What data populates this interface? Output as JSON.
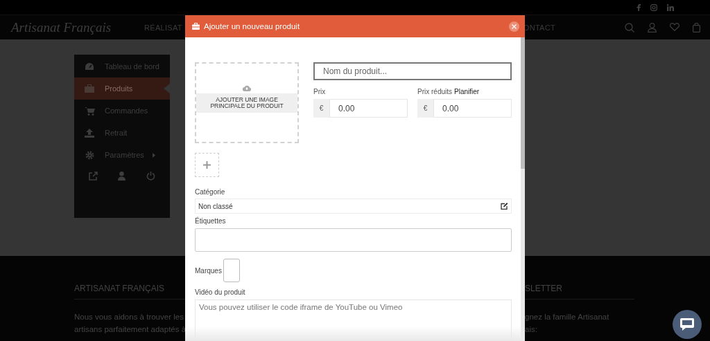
{
  "site": {
    "logo": "Artisanat Français",
    "nav": [
      {
        "label": "RÉALISAT"
      },
      {
        "label": "ONTACT"
      }
    ]
  },
  "sidebar": {
    "items": [
      {
        "label": "Tableau de bord",
        "selected": false,
        "has_submenu": false
      },
      {
        "label": "Produits",
        "selected": true,
        "has_submenu": false
      },
      {
        "label": "Commandes",
        "selected": false,
        "has_submenu": false
      },
      {
        "label": "Retrait",
        "selected": false,
        "has_submenu": false
      },
      {
        "label": "Paramètres",
        "selected": false,
        "has_submenu": true
      }
    ]
  },
  "footer": {
    "columns": [
      {
        "title": "ARTISANAT FRANÇAIS",
        "lines": [
          "Nous vous aidons à trouver les",
          "artisans parfaitement adaptés à"
        ]
      },
      {
        "title": "SLETTER",
        "lines": [
          "gnez la famille Artisanat",
          "ais:"
        ]
      }
    ]
  },
  "modal": {
    "title": "Ajouter un nouveau produit",
    "image_upload": {
      "label": "AJOUTER UNE IMAGE PRINCIPALE DU PRODUIT"
    },
    "name_field": {
      "placeholder": "Nom du produit..."
    },
    "price": {
      "label": "Prix",
      "currency": "€",
      "placeholder": "0.00"
    },
    "sale_price": {
      "label": "Prix réduits",
      "link": "Planifier",
      "currency": "€",
      "placeholder": "0.00"
    },
    "category": {
      "label": "Catégorie",
      "value": "Non classé"
    },
    "tags": {
      "label": "Étiquettes"
    },
    "brands": {
      "label": "Marques"
    },
    "video": {
      "label": "Vidéo du produit",
      "placeholder": "Vous pouvez utiliser le code iframe de YouTube ou Vimeo"
    }
  }
}
